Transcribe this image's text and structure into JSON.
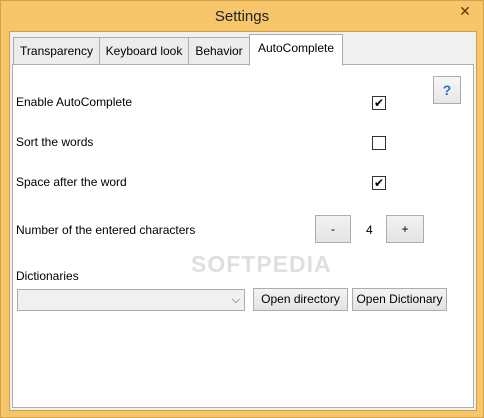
{
  "window": {
    "title": "Settings",
    "close_glyph": "✕"
  },
  "tabs": [
    {
      "label": "Transparency",
      "active": false
    },
    {
      "label": "Keyboard look",
      "active": false
    },
    {
      "label": "Behavior",
      "active": false
    },
    {
      "label": "AutoComplete",
      "active": true
    }
  ],
  "help": {
    "label": "?",
    "icon": "help-icon"
  },
  "options": [
    {
      "label": "Enable AutoComplete",
      "checked": true
    },
    {
      "label": "Sort the words",
      "checked": false
    },
    {
      "label": "Space after the word",
      "checked": true
    }
  ],
  "counter": {
    "label": "Number of the entered characters",
    "minus_label": "-",
    "value": "4",
    "plus_label": "+"
  },
  "dictionaries": {
    "label": "Dictionaries",
    "selected": "",
    "open_directory_label": "Open directory",
    "open_dictionary_label": "Open Dictionary"
  },
  "watermark": "SOFTPEDIA",
  "colors": {
    "frame": "#f7c56a",
    "help_icon": "#2c6ecb"
  }
}
